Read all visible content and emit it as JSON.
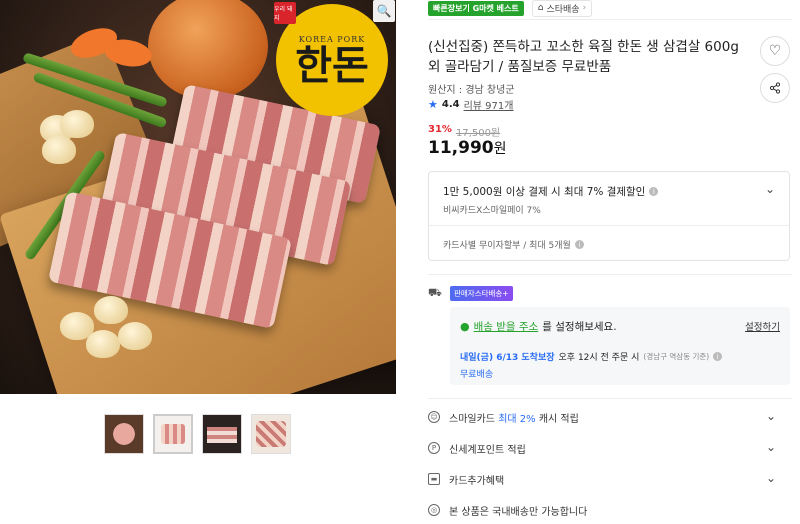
{
  "image": {
    "logo_korea_text": "KOREA PORK",
    "logo_glyph": "한돈",
    "logo_stamp": "우리 돼지",
    "zoom_icon": "search-icon"
  },
  "thumbnails": [
    "thumb-1",
    "thumb-2",
    "thumb-3",
    "thumb-4"
  ],
  "header": {
    "badge": "빠른장보기 G마켓 베스트",
    "star_ship_label": "스타배송"
  },
  "product": {
    "title": "(신선집중) 쫀득하고 꼬소한 육질 한돈 생 삼겹살 600g 외 골라담기 / 품질보증 무료반품",
    "origin": "원산지 : 경남 창녕군",
    "rating": "4.4",
    "reviews": "리뷰 971개",
    "discount": "31%",
    "original_price": "17,500원",
    "price": "11,990",
    "price_unit": "원"
  },
  "card_discount": {
    "line1": "1만 5,000원 이상 결제 시 최대 7% 결제할인",
    "line2": "비씨카드X스마일페이 7%",
    "line3": "카드사별 무이자할부 / 최대 5개월"
  },
  "shipping": {
    "badge": "판매자스타배송+",
    "address_link": "배송 받을 주소",
    "address_suffix": "를 설정해보세요.",
    "set_label": "설정하기",
    "date_highlight": "내일(금) 6/13 도착보장",
    "date_detail": "오후 12시 전 주문 시",
    "date_note": "(경남구 역삼동 기준)",
    "free": "무료배송"
  },
  "benefits": {
    "smile_prefix": "스마일카드",
    "smile_highlight": "최대 2%",
    "smile_suffix": "캐시 적립",
    "shinsegae": "신세계포인트 적립",
    "card_benefit": "카드추가혜택",
    "domestic": "본 상품은 국내배송만 가능합니다"
  },
  "colors": {
    "brand_green": "#25a32c",
    "discount_red": "#e3262f",
    "accent_blue": "#2a6df4"
  }
}
